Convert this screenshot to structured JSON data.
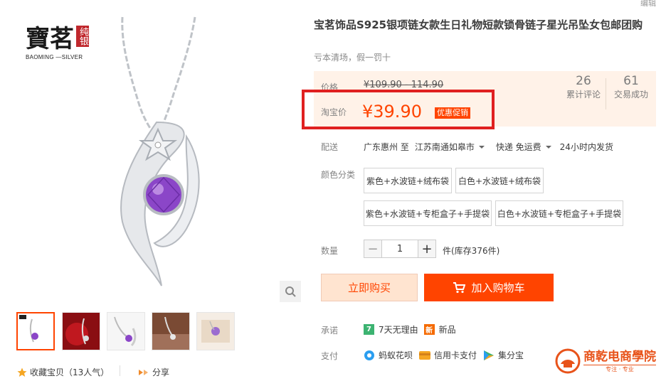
{
  "header": {
    "edit_label": "编辑"
  },
  "product": {
    "title": "宝茗饰品S925银项链女款生日礼物短款锁骨链子星光吊坠女包邮团购",
    "subtitle": "亏本清场，假一罚十"
  },
  "brand": {
    "logo_main": "寶茗",
    "logo_side": "纯银",
    "logo_en": "BAOMING —SILVER"
  },
  "price": {
    "label": "价格",
    "original": "¥109.90 - 114.90",
    "promo_label": "淘宝价",
    "promo_price": "¥39.90",
    "promo_tag": "优惠促销"
  },
  "stats": {
    "reviews_count": "26",
    "reviews_label": "累计评论",
    "sales_count": "61",
    "sales_label": "交易成功"
  },
  "shipping": {
    "label": "配送",
    "from": "广东惠州 至",
    "to": "江苏南通如皋市",
    "method": "快递 免运费",
    "dispatch": "24小时内发货"
  },
  "sku": {
    "label": "颜色分类",
    "options": [
      "紫色+水波链+绒布袋",
      "白色+水波链+绒布袋",
      "紫色+水波链+专柜盒子+手提袋",
      "白色+水波链+专柜盒子+手提袋"
    ]
  },
  "quantity": {
    "label": "数量",
    "minus": "−",
    "value": "1",
    "plus": "+",
    "stock": "件(库存376件)"
  },
  "actions": {
    "buy_now": "立即购买",
    "add_to_cart": "加入购物车"
  },
  "promise": {
    "label": "承诺",
    "seven_day": "7天无理由",
    "new_badge": "新",
    "new_text": "新品"
  },
  "payment": {
    "label": "支付",
    "huabei": "蚂蚁花呗",
    "credit": "信用卡支付",
    "jifen": "集分宝"
  },
  "footer": {
    "favorite": "收藏宝贝（13人气）",
    "share": "分享"
  },
  "watermark": {
    "name": "商乾电商學院",
    "slogan": "专注 · 专业"
  },
  "colors": {
    "accent": "#ff4400",
    "price_bg": "#fff2e8",
    "highlight_border": "#e02020"
  }
}
